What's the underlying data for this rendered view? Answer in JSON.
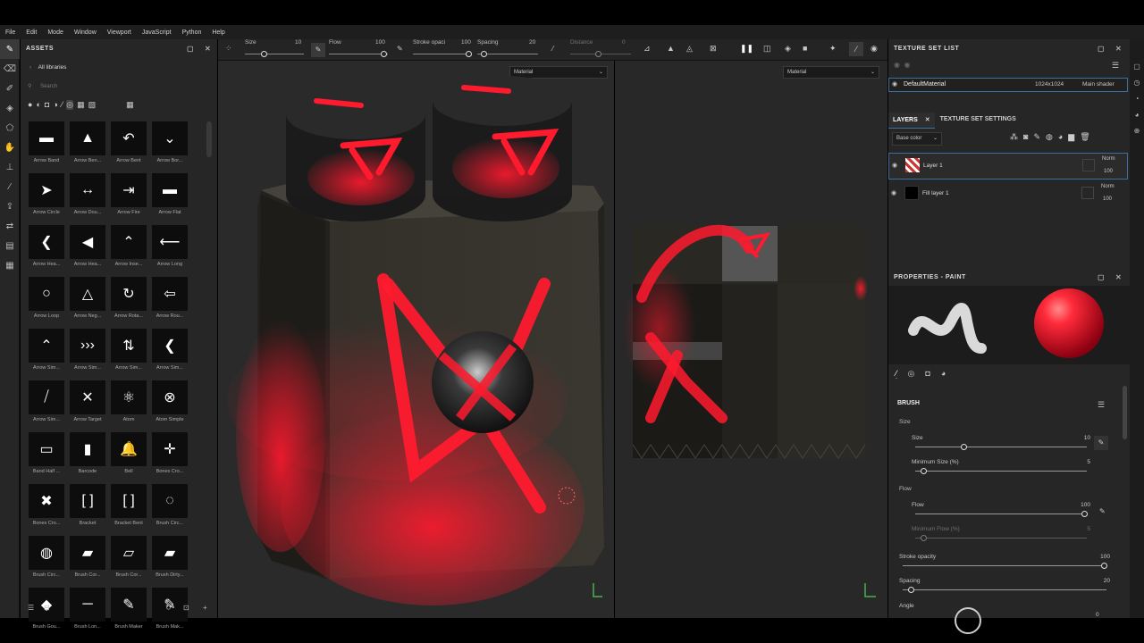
{
  "menu": [
    "File",
    "Edit",
    "Mode",
    "Window",
    "Viewport",
    "JavaScript",
    "Python",
    "Help"
  ],
  "assets": {
    "title": "ASSETS",
    "library": "All libraries",
    "search_placeholder": "Search",
    "items": [
      "Arrow Band",
      "Arrow Ben...",
      "Arrow Bent",
      "Arrow Bor...",
      "Arrow Circle",
      "Arrow Dou...",
      "Arrow Fire",
      "Arrow Flat",
      "Arrow Hea...",
      "Arrow Hea...",
      "Arrow Inse...",
      "Arrow Long",
      "Arrow Loop",
      "Arrow Neg...",
      "Arrow Rota...",
      "Arrow Rou...",
      "Arrow Sim...",
      "Arrow Sim...",
      "Arrow Sim...",
      "Arrow Sim...",
      "Arrow Sim...",
      "Arrow Target",
      "Atom",
      "Atom Simple",
      "Band Half ...",
      "Barcode",
      "Bell",
      "Bones Cro...",
      "Bones Cro...",
      "Bracket",
      "Bracket Bent",
      "Brush Circ...",
      "Brush Circ...",
      "Brush Cor...",
      "Brush Cor...",
      "Brush Dirty...",
      "Brush Gou...",
      "Brush Lon...",
      "Brush Maker",
      "Brush Mak..."
    ]
  },
  "toolbar": {
    "size_label": "Size",
    "size_value": "10",
    "flow_label": "Flow",
    "flow_value": "100",
    "opacity_label": "Stroke opaci",
    "opacity_value": "100",
    "spacing_label": "Spacing",
    "spacing_value": "20",
    "distance_label": "Distance",
    "distance_value": "0"
  },
  "viewport3d": {
    "material_dropdown": "Material"
  },
  "viewport2d": {
    "material_dropdown": "Material"
  },
  "texture_set_list": {
    "title": "TEXTURE SET LIST",
    "row": {
      "name": "DefaultMaterial",
      "resolution": "1024x1024",
      "shader": "Main shader"
    }
  },
  "layers": {
    "tab_layers": "LAYERS",
    "tab_settings": "TEXTURE SET SETTINGS",
    "channel": "Base color",
    "items": [
      {
        "name": "Layer 1",
        "blend": "Norm",
        "opacity": "100"
      },
      {
        "name": "Fill layer 1",
        "blend": "Norm",
        "opacity": "100"
      }
    ]
  },
  "properties": {
    "title": "PROPERTIES - PAINT",
    "brush_title": "BRUSH",
    "size_section": "Size",
    "size_label": "Size",
    "size_value": "10",
    "min_size_label": "Minimum Size (%)",
    "min_size_value": "5",
    "flow_section": "Flow",
    "flow_label": "Flow",
    "flow_value": "100",
    "min_flow_label": "Minimum Flow (%)",
    "min_flow_value": "5",
    "stroke_opacity_label": "Stroke opacity",
    "stroke_opacity_value": "100",
    "spacing_label": "Spacing",
    "spacing_value": "20",
    "angle_label": "Angle",
    "angle_value": "0"
  },
  "colors": {
    "accent": "#3d6fa3",
    "paint": "#ff1a2e",
    "panel": "#262626"
  }
}
